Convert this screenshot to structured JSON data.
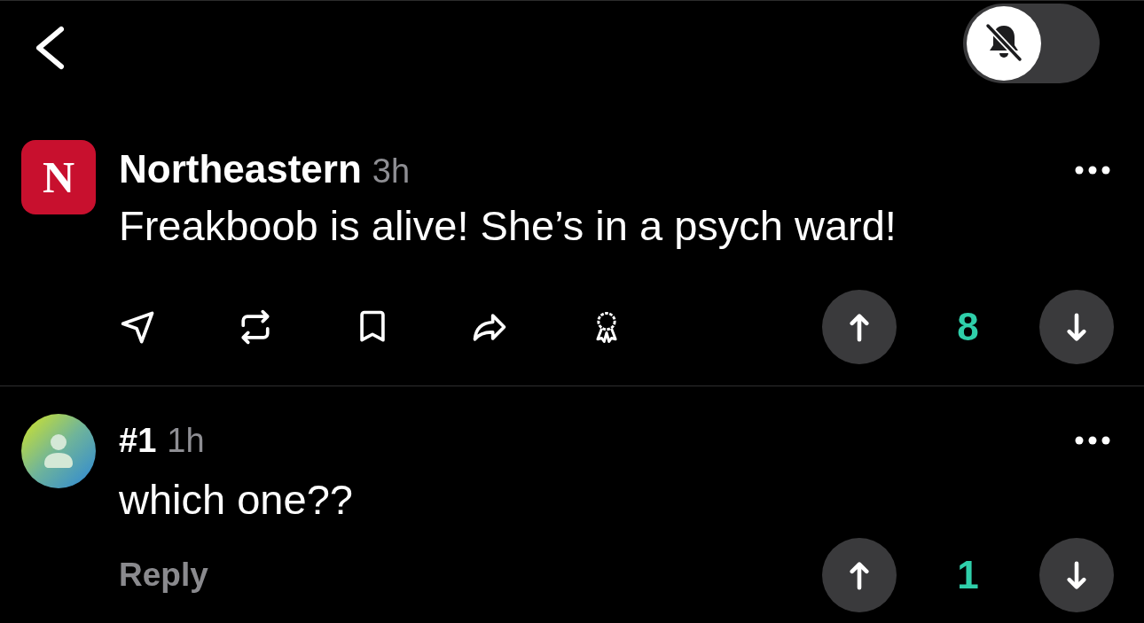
{
  "top_bar": {
    "notifications_toggle": {
      "on": false
    }
  },
  "post": {
    "logo_letter": "N",
    "author": "Northeastern",
    "time": "3h",
    "text": "Freakboob is alive! She’s in a psych ward!",
    "score": "8"
  },
  "comments": [
    {
      "author": "#1",
      "time": "1h",
      "text": "which one??",
      "reply_label": "Reply",
      "score": "1"
    }
  ]
}
